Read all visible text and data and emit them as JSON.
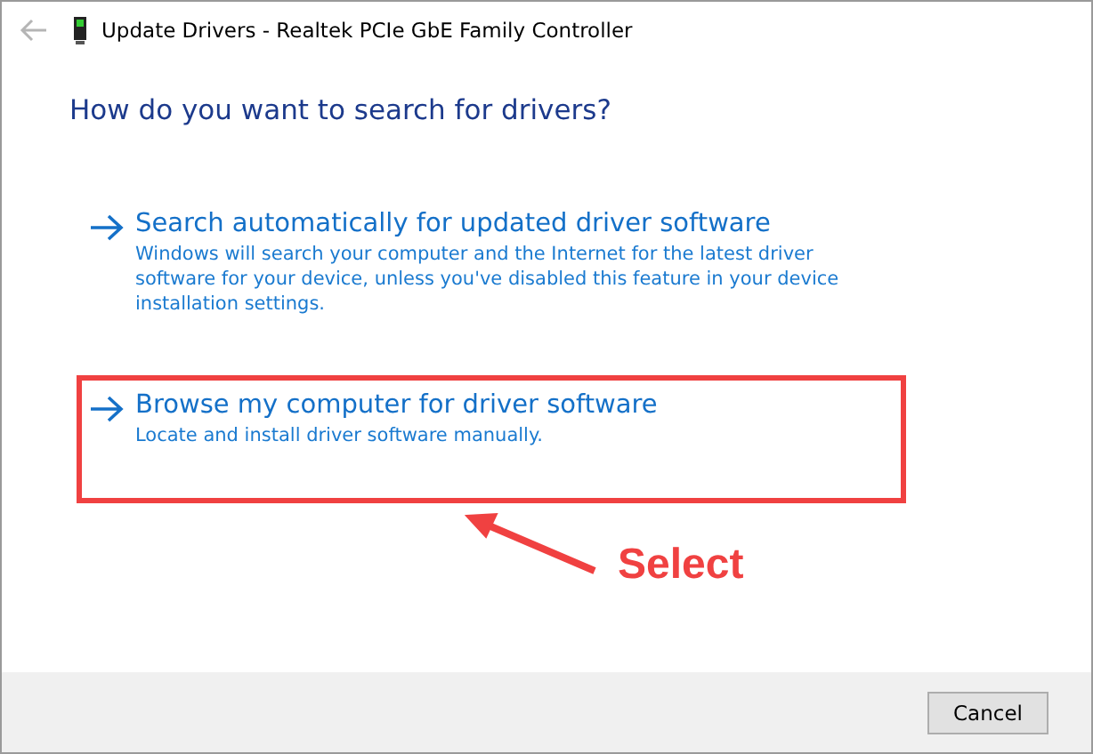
{
  "window": {
    "title": "Update Drivers - Realtek PCIe GbE Family Controller"
  },
  "heading": "How do you want to search for drivers?",
  "options": [
    {
      "title": "Search automatically for updated driver software",
      "description": "Windows will search your computer and the Internet for the latest driver software for your device, unless you've disabled this feature in your device installation settings.",
      "selected": false
    },
    {
      "title": "Browse my computer for driver software",
      "description": "Locate and install driver software manually.",
      "selected": true
    }
  ],
  "annotation": {
    "label": "Select"
  },
  "buttons": [
    "Cancel"
  ]
}
